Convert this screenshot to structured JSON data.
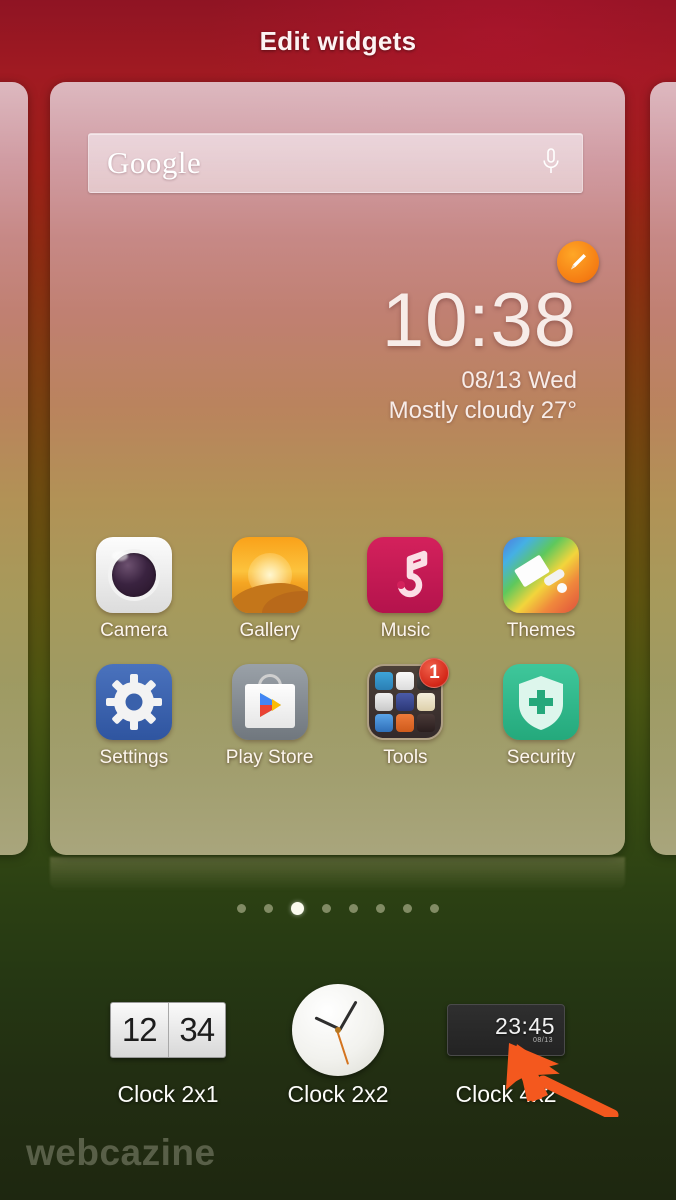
{
  "header": {
    "title": "Edit widgets"
  },
  "homescreen": {
    "search_widget": {
      "brand": "Google",
      "mic_icon": "microphone-icon"
    },
    "clock_widget": {
      "time": "10:38",
      "date": "08/13 Wed",
      "weather": "Mostly cloudy  27°",
      "edit_badge_icon": "pencil-icon"
    },
    "apps": [
      {
        "label": "Camera",
        "icon": "camera-icon"
      },
      {
        "label": "Gallery",
        "icon": "gallery-icon"
      },
      {
        "label": "Music",
        "icon": "music-note-icon"
      },
      {
        "label": "Themes",
        "icon": "paint-brush-icon"
      },
      {
        "label": "Settings",
        "icon": "gear-icon"
      },
      {
        "label": "Play Store",
        "icon": "play-store-bag-icon"
      },
      {
        "label": "Tools",
        "icon": "folder-icon",
        "badge": "1"
      },
      {
        "label": "Security",
        "icon": "shield-plus-icon"
      }
    ],
    "page_dots": {
      "count": 8,
      "active_index": 2
    }
  },
  "widget_tray": [
    {
      "label": "Clock 2x1",
      "preview_type": "flip-clock",
      "hours": "12",
      "minutes": "34"
    },
    {
      "label": "Clock 2x2",
      "preview_type": "analog-clock"
    },
    {
      "label": "Clock 4x2",
      "preview_type": "digital-clock",
      "time": "23:45",
      "sub": "08/13"
    }
  ],
  "cursor": {
    "icon": "arrow-pointer-icon",
    "color": "#f4581e"
  },
  "watermark": {
    "text": "webcazine"
  },
  "colors": {
    "accent_orange": "#f57c13",
    "badge_red": "#d32718",
    "title_text": "#fdf3f3",
    "bg_top": "#9d1f22",
    "bg_bottom": "#1e2710"
  }
}
